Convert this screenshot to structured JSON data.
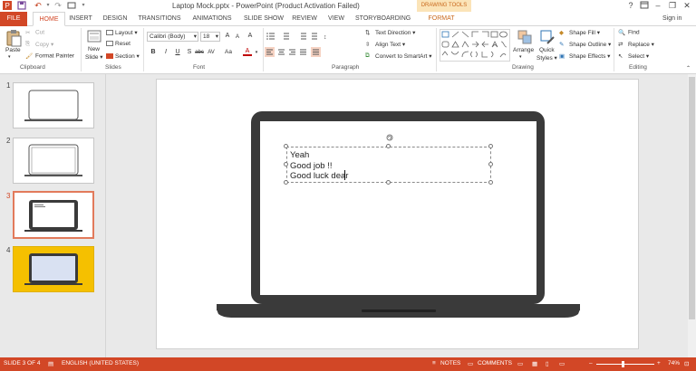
{
  "window": {
    "title": "Laptop Mock.pptx - PowerPoint (Product Activation Failed)",
    "contextual_label": "DRAWING TOOLS",
    "help": "?",
    "sign_in": "Sign in"
  },
  "tabs": [
    "FILE",
    "HOME",
    "INSERT",
    "DESIGN",
    "TRANSITIONS",
    "ANIMATIONS",
    "SLIDE SHOW",
    "REVIEW",
    "VIEW",
    "STORYBOARDING",
    "FORMAT"
  ],
  "ribbon": {
    "clipboard": {
      "paste": "Paste",
      "cut": "Cut",
      "copy": "Copy",
      "format_painter": "Format Painter",
      "label": "Clipboard"
    },
    "slides": {
      "new_slide": "New",
      "new_slide_2": "Slide",
      "layout": "Layout",
      "reset": "Reset",
      "section": "Section",
      "label": "Slides"
    },
    "font": {
      "name": "Calibri (Body)",
      "size": "18",
      "label": "Font",
      "bold": "B",
      "italic": "I",
      "underline": "U",
      "strike": "S",
      "shadow": "abc",
      "spacing": "AV",
      "case": "Aa",
      "color": "A",
      "grow": "A",
      "shrink": "A",
      "clear": "A"
    },
    "paragraph": {
      "text_direction": "Text Direction",
      "align_text": "Align Text",
      "convert_smartart": "Convert to SmartArt",
      "label": "Paragraph"
    },
    "drawing": {
      "arrange": "Arrange",
      "quick_styles": "Quick",
      "quick_styles_2": "Styles",
      "shape_fill": "Shape Fill",
      "shape_outline": "Shape Outline",
      "shape_effects": "Shape Effects",
      "label": "Drawing"
    },
    "editing": {
      "find": "Find",
      "replace": "Replace",
      "select": "Select",
      "label": "Editing"
    }
  },
  "thumbnails": [
    {
      "number": "1"
    },
    {
      "number": "2"
    },
    {
      "number": "3"
    },
    {
      "number": "4"
    }
  ],
  "slide": {
    "lines": [
      "Yeah",
      "Good job !!",
      "Good luck dear"
    ]
  },
  "status": {
    "slide_of": "SLIDE 3 OF 4",
    "language": "ENGLISH (UNITED STATES)",
    "notes": "NOTES",
    "comments": "COMMENTS",
    "zoom": "74%"
  },
  "colors": {
    "accent": "#d24726",
    "contextual": "#fbe4b8",
    "laptop": "#3a3a3a",
    "thumb4_bg": "#f5c000"
  }
}
